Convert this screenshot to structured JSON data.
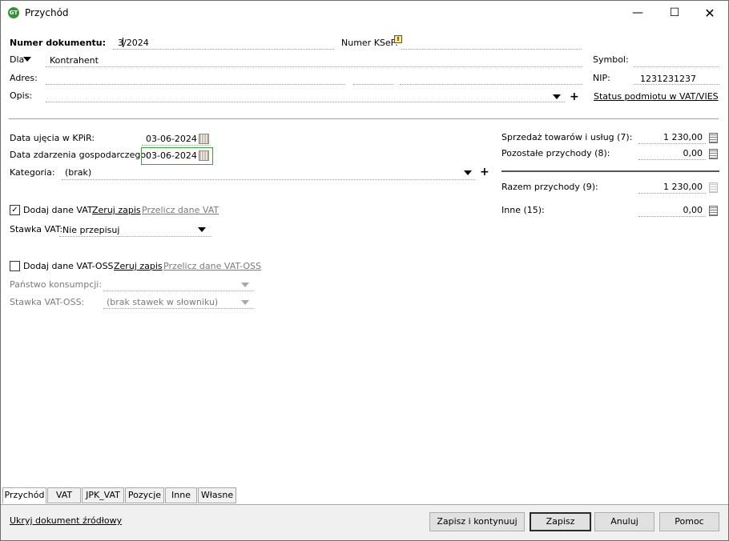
{
  "window": {
    "title": "Przychód",
    "app_icon_text": "GT"
  },
  "header": {
    "numer_label": "Numer dokumentu:",
    "numer_value": "3/2024",
    "ksef_label": "Numer KSeF:",
    "ksef_value": "",
    "dla_label": "Dla",
    "kontrahent_value": "Kontrahent",
    "symbol_label": "Symbol:",
    "symbol_value": "",
    "adres_label": "Adres:",
    "nip_label": "NIP:",
    "nip_value": "1231231237",
    "opis_label": "Opis:",
    "status_link": "Status podmiotu w VAT/VIES"
  },
  "dates": {
    "data_ujecia_label": "Data ujęcia w KPiR:",
    "data_ujecia_value": "03-06-2024",
    "data_zdarzenia_label": "Data zdarzenia gospodarczego:",
    "data_zdarzenia_value": "03-06-2024",
    "kategoria_label": "Kategoria:",
    "kategoria_value": "(brak)"
  },
  "vat": {
    "dodaj_label": "Dodaj dane VAT",
    "dodaj_checked": true,
    "zeruj_link": "Zeruj zapis",
    "przelicz_link": "Przelicz dane VAT",
    "stawka_label": "Stawka VAT:",
    "stawka_value": "Nie przepisuj"
  },
  "vatoss": {
    "dodaj_label": "Dodaj dane VAT-OSS",
    "dodaj_checked": false,
    "zeruj_link": "Zeruj zapis",
    "przelicz_link": "Przelicz dane VAT-OSS",
    "panstwo_label": "Państwo konsumpcji:",
    "panstwo_value": "",
    "stawka_label": "Stawka VAT-OSS:",
    "stawka_value": "(brak stawek w słowniku)"
  },
  "amounts": {
    "sprzedaz_label": "Sprzedaż towarów i usług (7):",
    "sprzedaz_value": "1 230,00",
    "pozostale_label": "Pozostałe przychody (8):",
    "pozostale_value": "0,00",
    "razem_label": "Razem przychody (9):",
    "razem_value": "1 230,00",
    "inne_label": "Inne (15):",
    "inne_value": "0,00"
  },
  "tabs": [
    "Przychód",
    "VAT",
    "JPK_VAT",
    "Pozycje",
    "Inne",
    "Własne"
  ],
  "footer": {
    "ukryj_link": "Ukryj dokument źródłowy",
    "zapisz_kontynuuj": "Zapisz i kontynuuj",
    "zapisz": "Zapisz",
    "anuluj": "Anuluj",
    "pomoc": "Pomoc"
  },
  "colors": {
    "accent_border": "#3aa43a",
    "icon_green": "#3a8f3a"
  }
}
